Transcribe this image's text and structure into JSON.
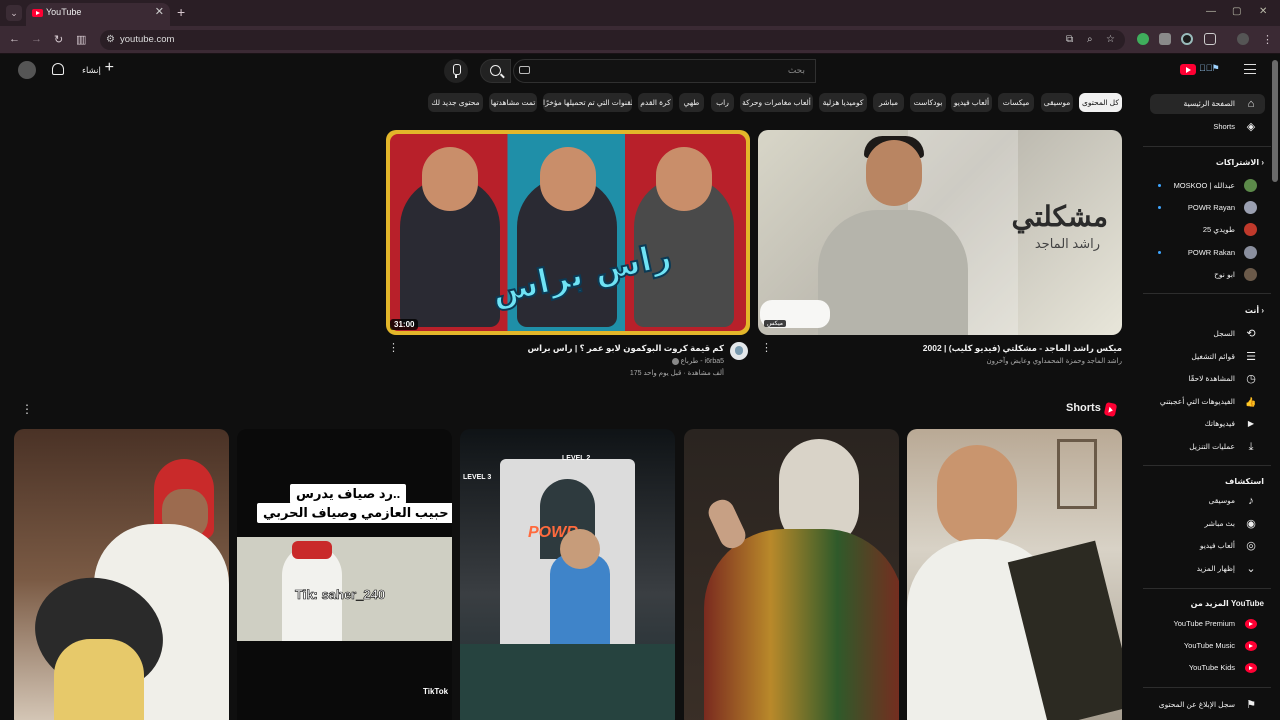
{
  "browser": {
    "tab_title": "YouTube",
    "url": "youtube.com",
    "tab_close": "✕",
    "new_tab": "+",
    "tab_list_glyph": "⌄",
    "window_controls": {
      "minimize": "—",
      "maximize": "▢",
      "close": "✕"
    }
  },
  "masthead": {
    "search_placeholder": "بحث",
    "create_label": "إنشاء",
    "create_icon": "+"
  },
  "chips": [
    {
      "label": "كل المحتوى",
      "active": true
    },
    {
      "label": "موسيقى"
    },
    {
      "label": "ميكسات"
    },
    {
      "label": "ألعاب فيديو"
    },
    {
      "label": "بودكاست"
    },
    {
      "label": "مباشر"
    },
    {
      "label": "كوميديا هزلية"
    },
    {
      "label": "ألعاب مغامرات وحركة"
    },
    {
      "label": "راب"
    },
    {
      "label": "طهي"
    },
    {
      "label": "كرة القدم"
    },
    {
      "label": "القنوات التي تم تحميلها مؤخرًا"
    },
    {
      "label": "تمت مشاهدتها"
    },
    {
      "label": "محتوى جديد لك"
    }
  ],
  "sidebar": {
    "main": [
      {
        "label": "الصفحة الرئيسية",
        "icon": "home-icon",
        "glyph": "⌂",
        "active": true
      },
      {
        "label": "Shorts",
        "icon": "shorts-icon",
        "glyph": "◈"
      }
    ],
    "subscriptions_header": "الاشتراكات",
    "subscriptions": [
      {
        "label": "MOSKOO | عبدالله",
        "color": "#5c8a4a"
      },
      {
        "label": "POWR Rayan",
        "color": "#9a9fb0"
      },
      {
        "label": "طويدي 25",
        "color": "#c0392b"
      },
      {
        "label": "POWR Rakan",
        "color": "#8a8f9e"
      },
      {
        "label": "ابو نوح",
        "color": "#6b5a4a"
      }
    ],
    "you_header": "أنت",
    "you": [
      {
        "label": "السجل",
        "icon": "history-icon",
        "glyph": "⟲"
      },
      {
        "label": "قوائم التشغيل",
        "icon": "playlists-icon",
        "glyph": "☰"
      },
      {
        "label": "المشاهدة لاحقًا",
        "icon": "watch-later-icon",
        "glyph": "◷"
      },
      {
        "label": "الفيديوهات التي أعجبتني",
        "icon": "like-icon",
        "glyph": "👍"
      },
      {
        "label": "فيديوهاتك",
        "icon": "your-videos-icon",
        "glyph": "▶"
      },
      {
        "label": "عمليات التنزيل",
        "icon": "download-icon",
        "glyph": "⤓"
      }
    ],
    "explore_header": "استكشاف",
    "explore": [
      {
        "label": "موسيقى",
        "icon": "music-icon",
        "glyph": "♪"
      },
      {
        "label": "بث مباشر",
        "icon": "live-icon",
        "glyph": "◉"
      },
      {
        "label": "ألعاب فيديو",
        "icon": "gaming-icon",
        "glyph": "◎"
      },
      {
        "label": "إظهار المزيد",
        "icon": "chevron-down-icon",
        "glyph": "⌄"
      }
    ],
    "more_header": "المزيد من YouTube",
    "more": [
      {
        "label": "YouTube Premium"
      },
      {
        "label": "YouTube Music"
      },
      {
        "label": "YouTube Kids"
      }
    ],
    "report_label": "سجل الإبلاغ عن المحتوى",
    "report_glyph": "⚑"
  },
  "videos": [
    {
      "title": "ميكس راشد الماجد - مشكلتي (فيديو كليب) | 2002",
      "meta": "راشد الماجد وحمزة المحمداوي وعايض وآخرون",
      "thumb_title": "مشكلتي",
      "thumb_subtitle": "راشد الماجد",
      "badge": "ميكس"
    },
    {
      "title": "كم قيمة كروت البوكمون لابو عمر ؟ | راس براس",
      "channel": "طرباع - i6rba5",
      "views": "175 ألف مشاهدة · قبل يوم واحد",
      "duration": "31:00",
      "thumb_text": "راس براس"
    }
  ],
  "shorts": {
    "title": "Shorts",
    "items": [
      {
        "overlay": ""
      },
      {
        "overlay": ""
      },
      {
        "level_a": "LEVEL 3",
        "level_b": "LEVEL 2",
        "sign": "POWR"
      },
      {
        "caption_1": "رد صياف يدرس..",
        "caption_2": "حبيب العازمي وصياف الحربي",
        "watermark": "Tik: saher_240",
        "brand": "TikTok"
      },
      {
        "overlay": ""
      }
    ]
  },
  "colors": {
    "background": "#0f0f0f",
    "brand_red": "#ff0033",
    "chip_bg": "#272727",
    "chip_active_bg": "#f1f1f1"
  }
}
